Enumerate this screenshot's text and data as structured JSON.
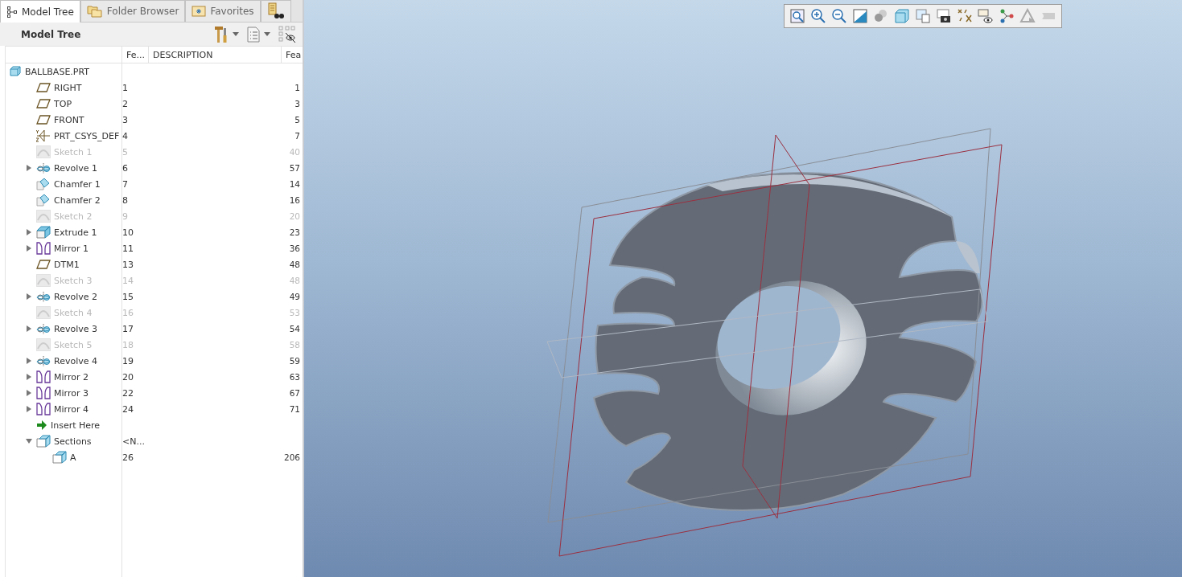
{
  "tabs": [
    {
      "label": "Model Tree",
      "kind": "tree",
      "selected": true
    },
    {
      "label": "Folder Browser",
      "kind": "folder",
      "selected": false
    },
    {
      "label": "Favorites",
      "kind": "favorites",
      "selected": false
    },
    {
      "kind": "search",
      "selected": false
    }
  ],
  "panel": {
    "title": "Model Tree"
  },
  "columns": [
    "Fe...",
    "DESCRIPTION",
    "Fea"
  ],
  "tree": {
    "name": "BALLBASE.PRT",
    "kind": "part",
    "children": [
      {
        "name": "RIGHT",
        "kind": "plane",
        "number": "1",
        "column_3": "1",
        "dimmed": false
      },
      {
        "name": "TOP",
        "kind": "plane",
        "number": "2",
        "column_3": "3",
        "dimmed": false
      },
      {
        "name": "FRONT",
        "kind": "plane",
        "number": "3",
        "column_3": "5",
        "dimmed": false
      },
      {
        "name": "PRT_CSYS_DEF",
        "kind": "csys",
        "number": "4",
        "column_3": "7",
        "dimmed": false
      },
      {
        "name": "Sketch 1",
        "kind": "sketch",
        "number": "5",
        "column_3": "40",
        "dimmed": true
      },
      {
        "name": "Revolve 1",
        "kind": "revolve",
        "number": "6",
        "column_3": "57",
        "dimmed": false,
        "expanded": false
      },
      {
        "name": "Chamfer 1",
        "kind": "chamfer",
        "number": "7",
        "column_3": "14",
        "dimmed": false
      },
      {
        "name": "Chamfer 2",
        "kind": "chamfer",
        "number": "8",
        "column_3": "16",
        "dimmed": false
      },
      {
        "name": "Sketch 2",
        "kind": "sketch",
        "number": "9",
        "column_3": "20",
        "dimmed": true
      },
      {
        "name": "Extrude 1",
        "kind": "extrude",
        "number": "10",
        "column_3": "23",
        "dimmed": false,
        "expanded": false
      },
      {
        "name": "Mirror 1",
        "kind": "mirror",
        "number": "11",
        "column_3": "36",
        "dimmed": false,
        "expanded": false
      },
      {
        "name": "DTM1",
        "kind": "plane",
        "number": "13",
        "column_3": "48",
        "dimmed": false
      },
      {
        "name": "Sketch 3",
        "kind": "sketch",
        "number": "14",
        "column_3": "48",
        "dimmed": true
      },
      {
        "name": "Revolve 2",
        "kind": "revolve",
        "number": "15",
        "column_3": "49",
        "dimmed": false,
        "expanded": false
      },
      {
        "name": "Sketch 4",
        "kind": "sketch",
        "number": "16",
        "column_3": "53",
        "dimmed": true
      },
      {
        "name": "Revolve 3",
        "kind": "revolve",
        "number": "17",
        "column_3": "54",
        "dimmed": false,
        "expanded": false
      },
      {
        "name": "Sketch 5",
        "kind": "sketch",
        "number": "18",
        "column_3": "58",
        "dimmed": true
      },
      {
        "name": "Revolve 4",
        "kind": "revolve",
        "number": "19",
        "column_3": "59",
        "dimmed": false,
        "expanded": false
      },
      {
        "name": "Mirror 2",
        "kind": "mirror",
        "number": "20",
        "column_3": "63",
        "dimmed": false,
        "expanded": false
      },
      {
        "name": "Mirror 3",
        "kind": "mirror",
        "number": "22",
        "column_3": "67",
        "dimmed": false,
        "expanded": false
      },
      {
        "name": "Mirror 4",
        "kind": "mirror",
        "number": "24",
        "column_3": "71",
        "dimmed": false,
        "expanded": false
      },
      {
        "name": "Insert Here",
        "kind": "insert",
        "dimmed": false
      },
      {
        "name": "Sections",
        "kind": "section",
        "number": "<N...",
        "dimmed": false,
        "expanded": true,
        "children": [
          {
            "name": "A",
            "kind": "section",
            "number": "26",
            "column_3": "206",
            "dimmed": false
          }
        ]
      }
    ]
  }
}
